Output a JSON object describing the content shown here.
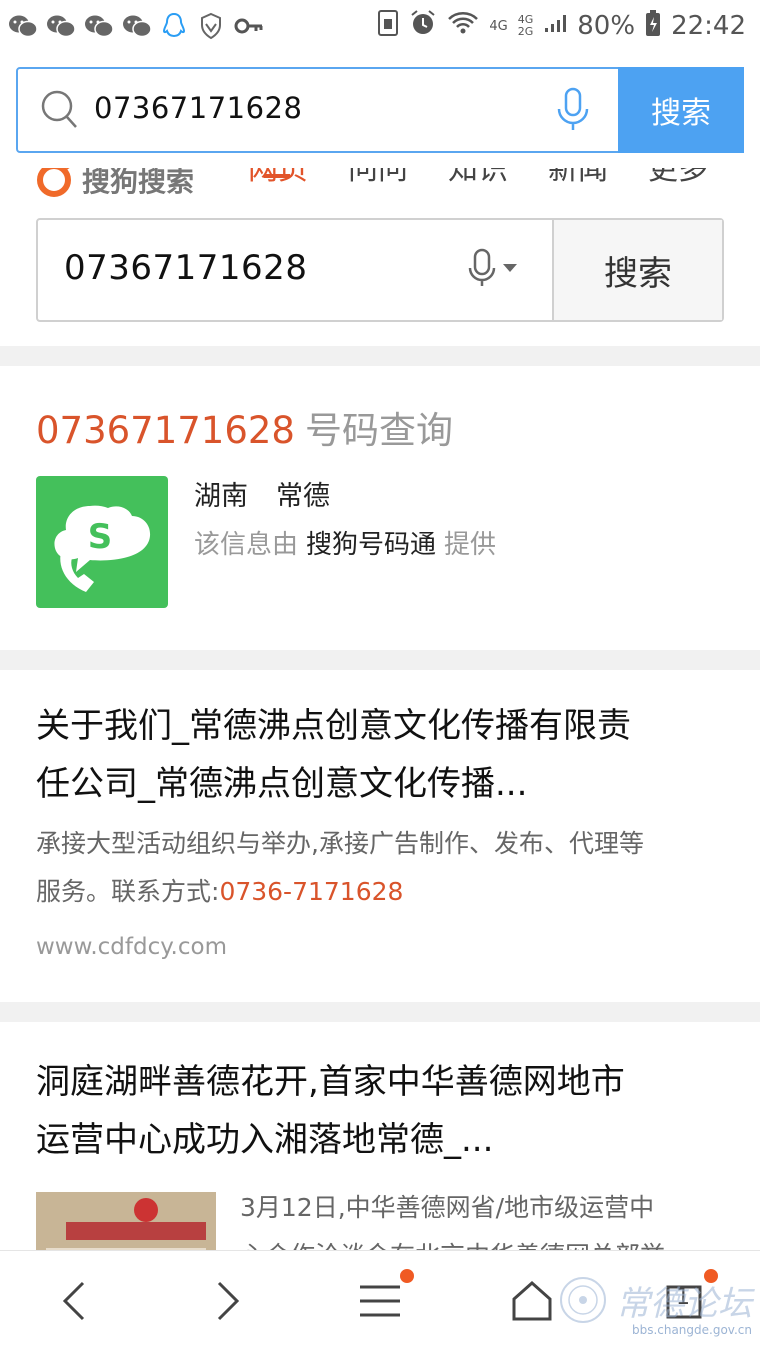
{
  "status_bar": {
    "network": "4G",
    "network2_top": "4G",
    "network2_bottom": "2G",
    "battery": "80%",
    "time": "22:42"
  },
  "address_bar": {
    "query": "07367171628",
    "search_label": "搜索"
  },
  "sogou": {
    "logo_text": "搜狗搜索",
    "tabs": [
      "网页",
      "问问",
      "知识",
      "新闻",
      "更多"
    ],
    "search_query": "07367171628",
    "search_label": "搜索"
  },
  "phone_card": {
    "number": "07367171628",
    "suffix": "号码查询",
    "province": "湖南",
    "city": "常德",
    "provider_prefix": "该信息由",
    "provider_name": "搜狗号码通",
    "provider_suffix": "提供"
  },
  "results": [
    {
      "title_line1": "关于我们_常德沸点创意文化传播有限责",
      "title_line2": "任公司_常德沸点创意文化传播...",
      "desc_line1": "承接大型活动组织与举办,承接广告制作、发布、代理等",
      "desc_line2_prefix": "服务。联系方式:",
      "desc_line2_highlight": "0736-7171628",
      "url": "www.cdfdcy.com"
    },
    {
      "title_line1": "洞庭湖畔善德花开,首家中华善德网地市",
      "title_line2": "运营中心成功入湘落地常德_...",
      "excerpt_line1": "3月12日,中华善德网省/地市级运营中",
      "excerpt_line2": "心合作洽谈会在北京中华善德网总部举"
    }
  ],
  "bottom_nav": {
    "tab_count": "1"
  },
  "watermark": {
    "text": "常德论坛",
    "url": "bbs.changde.gov.cn"
  },
  "colors": {
    "accent_blue": "#4da2f2",
    "sogou_orange": "#e2542a",
    "app_green": "#44c05b"
  }
}
